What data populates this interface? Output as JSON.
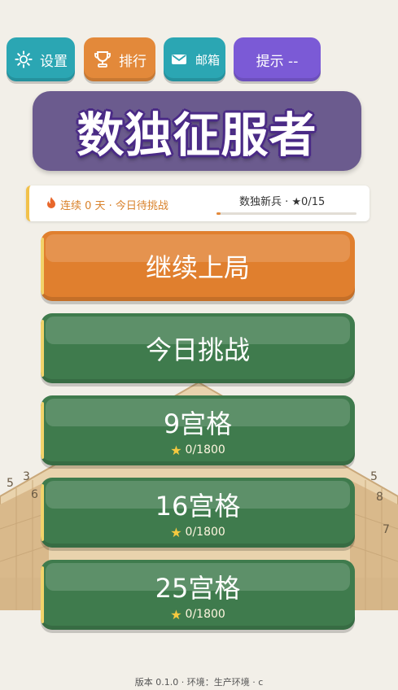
{
  "topbar": {
    "settings_label": "设置",
    "settings_icon": "gear-icon",
    "rank_label": "排行",
    "rank_icon": "trophy-icon",
    "mail_label": "邮箱",
    "mail_icon": "mail-icon",
    "hint_label": "提示 --"
  },
  "title": "数独征服者",
  "status": {
    "streak_text": "连续 0 天 · 今日待挑战",
    "streak_icon": "flame-icon",
    "rank_text": "数独新兵 · ★0/15",
    "progress_fraction": 0.0
  },
  "menu": {
    "continue_label": "继续上局",
    "daily_label": "今日挑战",
    "grid9_label": "9宫格",
    "grid9_stars": "0/1800",
    "grid16_label": "16宫格",
    "grid16_stars": "0/1800",
    "grid25_label": "25宫格",
    "grid25_stars": "0/1800"
  },
  "footer": {
    "version_text": "版本 0.1.0 · 环境：生产环境 · c"
  },
  "colors": {
    "teal": "#2ba6b3",
    "orange": "#e07f2e",
    "purple": "#7b5ad6",
    "green": "#3f7b4d",
    "title_bg": "#6b5b8e",
    "background": "#f2efe8"
  }
}
